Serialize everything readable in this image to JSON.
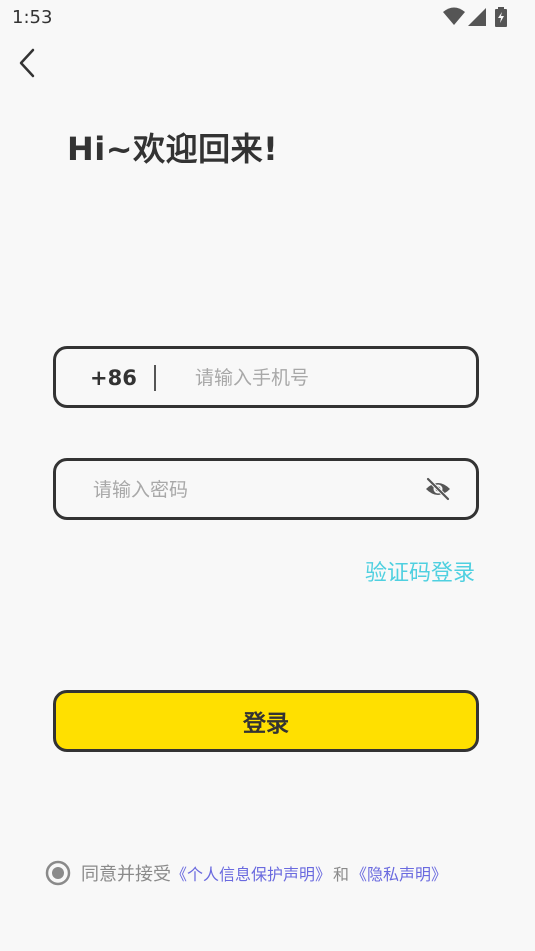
{
  "status_bar": {
    "time": "1:53",
    "icons": [
      "wifi-icon",
      "cell-signal-icon",
      "battery-charging-icon"
    ]
  },
  "header": {
    "back_icon": "chevron-left-icon",
    "welcome": "Hi~欢迎回来!"
  },
  "phone_field": {
    "country_code": "+86",
    "value": "",
    "placeholder": "请输入手机号"
  },
  "password_field": {
    "value": "",
    "placeholder": "请输入密码",
    "visibility_icon": "eye-off-icon"
  },
  "sms_login_label": "验证码登录",
  "login_button_label": "登录",
  "agreement": {
    "checked": true,
    "prefix": "同意并接受",
    "privacy_link": "《个人信息保护声明》",
    "and": "和",
    "privacy_link_2": "《隐私声明》"
  },
  "colors": {
    "accent_yellow": "#ffe000",
    "link_cyan": "#4fd0e0",
    "link_purple": "#6a6adf",
    "text_dark": "#333333",
    "background": "#f8f8f8"
  }
}
